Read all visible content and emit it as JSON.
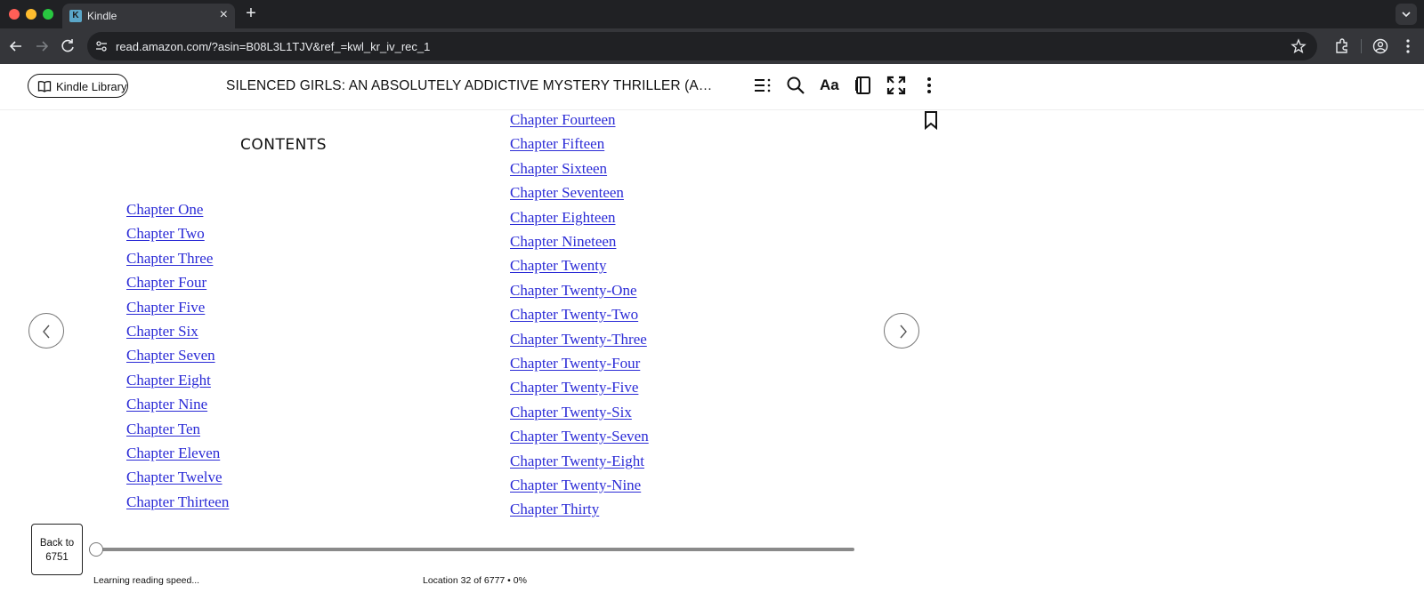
{
  "browser": {
    "tab_title": "Kindle",
    "tab_favicon": "K",
    "tab_close": "×",
    "new_tab": "+",
    "url": "read.amazon.com/?asin=B08L3L1TJV&ref_=kwl_kr_iv_rec_1"
  },
  "reader": {
    "library_label": "Kindle Library",
    "book_title": "SILENCED GIRLS: AN ABSOLUTELY ADDICTIVE MYSTERY THRILLER (AGENT ...",
    "font_settings_label": "Aa",
    "icons": [
      "table-of-contents-icon",
      "search-icon",
      "font-settings-icon",
      "notebook-icon",
      "fullscreen-icon",
      "more-options-icon",
      "bookmark-icon"
    ]
  },
  "contents": {
    "heading": "CONTENTS",
    "column_left": [
      "Chapter One",
      "Chapter Two",
      "Chapter Three",
      "Chapter Four",
      "Chapter Five",
      "Chapter Six",
      "Chapter Seven",
      "Chapter Eight",
      "Chapter Nine",
      "Chapter Ten",
      "Chapter Eleven",
      "Chapter Twelve",
      "Chapter Thirteen"
    ],
    "column_right": [
      "Chapter Fourteen",
      "Chapter Fifteen",
      "Chapter Sixteen",
      "Chapter Seventeen",
      "Chapter Eighteen",
      "Chapter Nineteen",
      "Chapter Twenty",
      "Chapter Twenty-One",
      "Chapter Twenty-Two",
      "Chapter Twenty-Three",
      "Chapter Twenty-Four",
      "Chapter Twenty-Five",
      "Chapter Twenty-Six",
      "Chapter Twenty-Seven",
      "Chapter Twenty-Eight",
      "Chapter Twenty-Nine",
      "Chapter Thirty"
    ],
    "link_color": "#2b2bd6"
  },
  "footer": {
    "back_to_line1": "Back to",
    "back_to_line2": "6751",
    "reading_speed": "Learning reading speed...",
    "location": "Location 32 of 6777 • 0%",
    "progress_fraction": 0.0
  }
}
